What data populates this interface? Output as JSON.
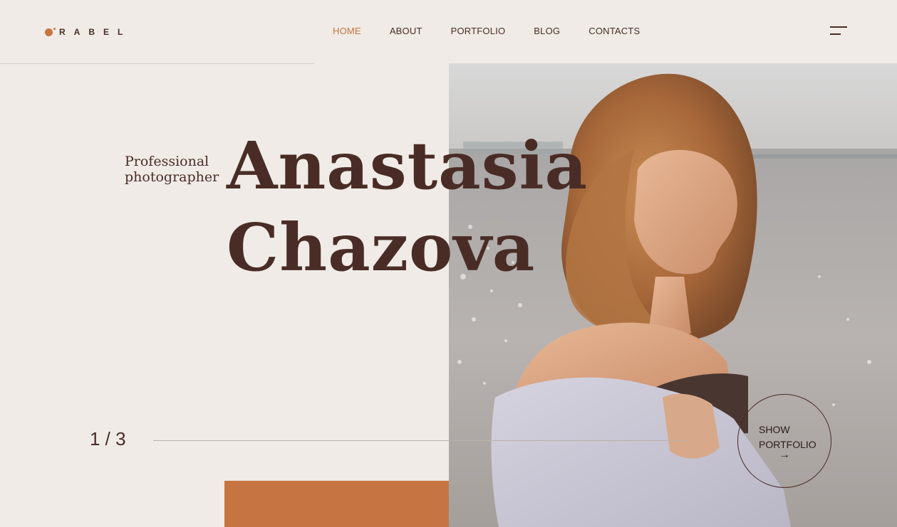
{
  "brand": {
    "logo_text": "RABEL",
    "accent_color": "#c67542",
    "text_color": "#4a2c26"
  },
  "nav": {
    "items": [
      {
        "label": "HOME",
        "active": true
      },
      {
        "label": "ABOUT",
        "active": false
      },
      {
        "label": "PORTFOLIO",
        "active": false
      },
      {
        "label": "BLOG",
        "active": false
      },
      {
        "label": "CONTACTS",
        "active": false
      }
    ],
    "menu_icon": "hamburger-menu-icon"
  },
  "hero": {
    "subtitle_line1": "Professional",
    "subtitle_line2": "photographer",
    "name_line1": "Anastasia",
    "name_line2": "Chazova",
    "image": "portrait of a woman with wavy hair wrapped in a white blanket by the sea"
  },
  "slider": {
    "counter": "1 / 3"
  },
  "cta": {
    "line1": "SHOW",
    "line2": "PORTFOLIO",
    "arrow": "→"
  }
}
